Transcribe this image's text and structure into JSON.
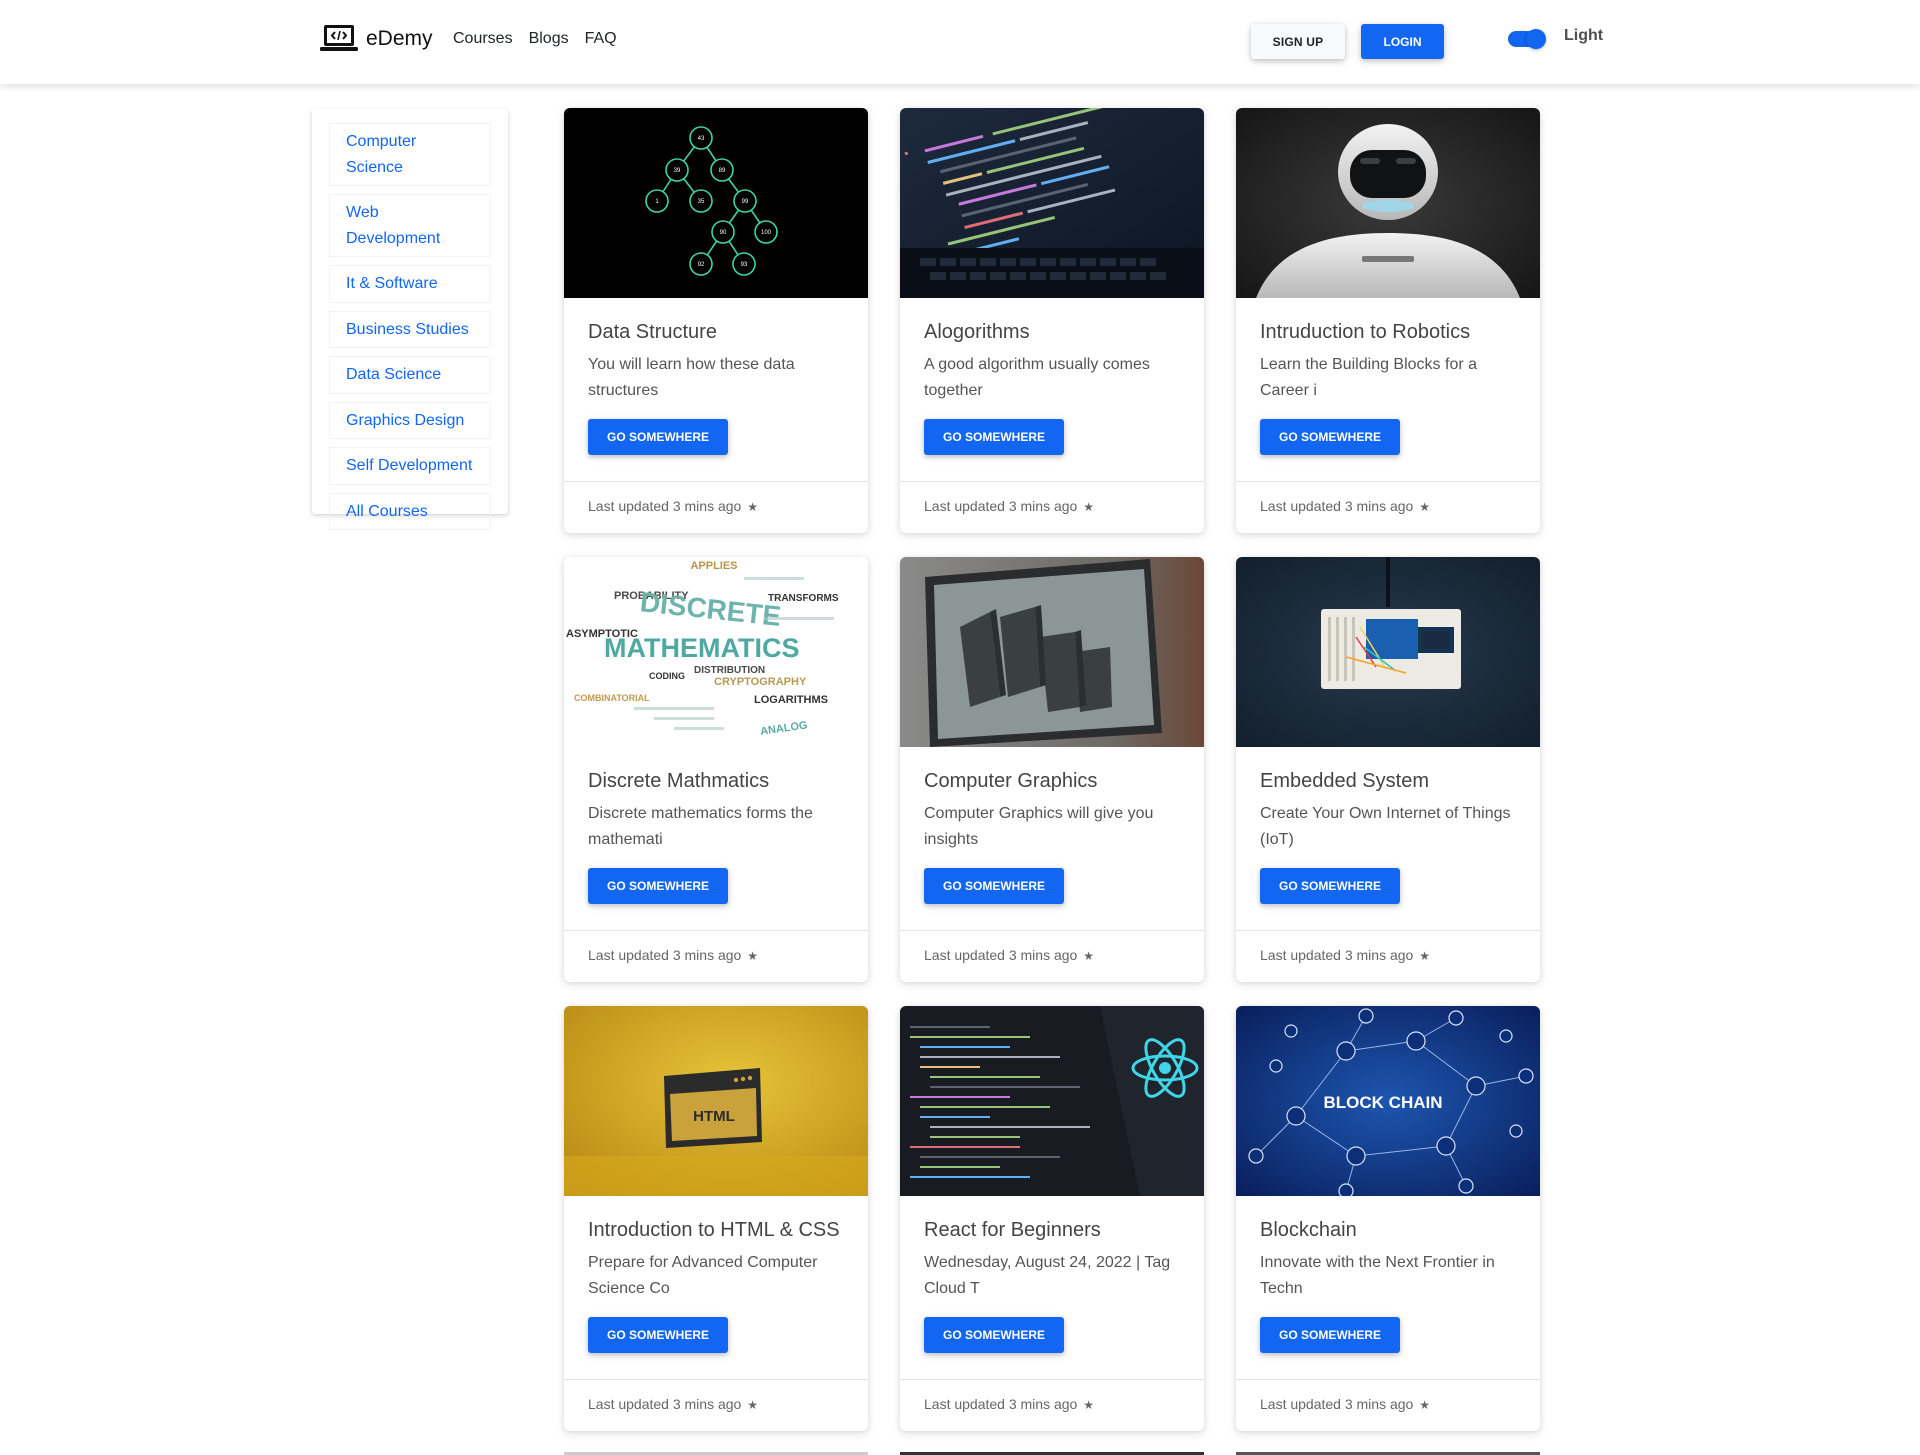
{
  "brand": {
    "name": "eDemy"
  },
  "nav": {
    "links": [
      "Courses",
      "Blogs",
      "FAQ"
    ]
  },
  "header": {
    "signup_label": "SIGN UP",
    "login_label": "LOGIN",
    "theme_label": "Light"
  },
  "sidebar": {
    "items": [
      "Computer Science",
      "Web Development",
      "It & Software",
      "Business Studies",
      "Data Science",
      "Graphics Design",
      "Self Development",
      "All Courses"
    ]
  },
  "colors": {
    "accent": "#1266f1",
    "link": "#1266f1"
  },
  "cards": [
    {
      "title": "Data Structure",
      "text": "You will learn how these data structures",
      "button": "GO SOMEWHERE",
      "footer": "Last updated 3 mins ago",
      "image": "binary-tree-image",
      "tree_labels": [
        "43",
        "39",
        "89",
        "1",
        "35",
        "99",
        "90",
        "100",
        "92",
        "93"
      ]
    },
    {
      "title": "Alogorithms",
      "text": "A good algorithm usually comes together",
      "button": "GO SOMEWHERE",
      "footer": "Last updated 3 mins ago",
      "image": "code-laptop-image"
    },
    {
      "title": "Intruduction to Robotics",
      "text": "Learn the Building Blocks for a Career i",
      "button": "GO SOMEWHERE",
      "footer": "Last updated 3 mins ago",
      "image": "robot-image"
    },
    {
      "title": "Discrete Mathmatics",
      "text": "Discrete mathematics forms the mathemati",
      "button": "GO SOMEWHERE",
      "footer": "Last updated 3 mins ago",
      "image": "word-cloud-image",
      "cloud_words": [
        "DISCRETE",
        "MATHEMATICS",
        "PROBABILITY",
        "ASYMPTOTIC",
        "LOGARITHMS",
        "CRYPTOGRAPHY",
        "DISTRIBUTION",
        "COMBINATORIAL",
        "TRANSFORMS",
        "ANALOG",
        "APPLIES",
        "CODING"
      ]
    },
    {
      "title": "Computer Graphics",
      "text": "Computer Graphics will give you insights",
      "button": "GO SOMEWHERE",
      "footer": "Last updated 3 mins ago",
      "image": "3d-monitor-image"
    },
    {
      "title": "Embedded System",
      "text": "Create Your Own Internet of Things (IoT)",
      "button": "GO SOMEWHERE",
      "footer": "Last updated 3 mins ago",
      "image": "breadboard-image"
    },
    {
      "title": "Introduction to HTML & CSS",
      "text": "Prepare for Advanced Computer Science Co",
      "button": "GO SOMEWHERE",
      "footer": "Last updated 3 mins ago",
      "image": "html-window-image",
      "html_badge": "HTML"
    },
    {
      "title": "React for Beginners",
      "text": "Wednesday, August 24, 2022 | Tag Cloud T",
      "button": "GO SOMEWHERE",
      "footer": "Last updated 3 mins ago",
      "image": "react-code-image"
    },
    {
      "title": "Blockchain",
      "text": "Innovate with the Next Frontier in Techn",
      "button": "GO SOMEWHERE",
      "footer": "Last updated 3 mins ago",
      "image": "blockchain-network-image",
      "image_text": "BLOCK CHAIN"
    }
  ]
}
